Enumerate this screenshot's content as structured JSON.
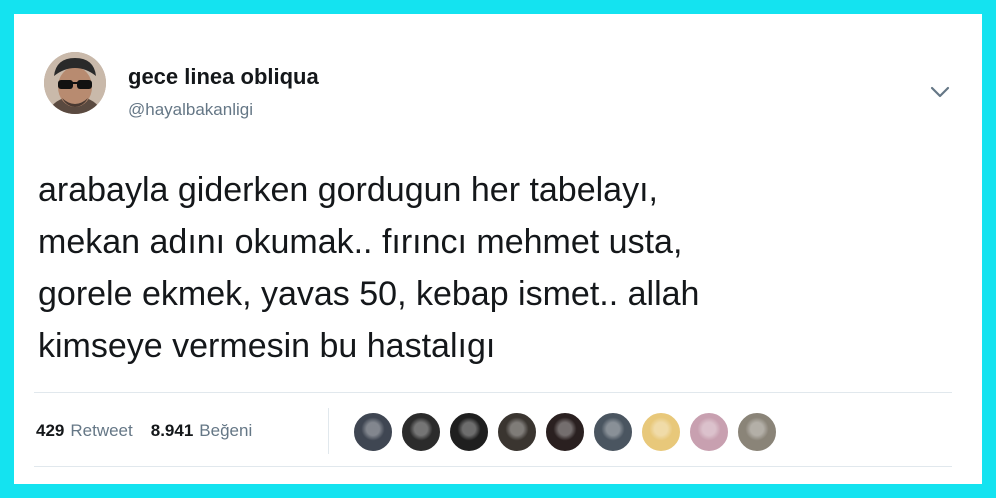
{
  "tweet": {
    "author": {
      "name": "gece linea obliqua",
      "handle": "@hayalbakanligi"
    },
    "text_lines": [
      "arabayla giderken gordugun her tabelayı,",
      "mekan adını okumak.. fırıncı mehmet usta,",
      "gorele ekmek, yavas 50, kebap ismet.. allah",
      "kimseye vermesin bu hastalıgı"
    ],
    "stats": {
      "retweet_count": "429",
      "retweet_label": "Retweet",
      "like_count": "8.941",
      "like_label": "Beğeni"
    },
    "likers": [
      {
        "name": "liker-avatar-1",
        "color": "#3f4652"
      },
      {
        "name": "liker-avatar-2",
        "color": "#2b2b2b"
      },
      {
        "name": "liker-avatar-3",
        "color": "#1f1f1f"
      },
      {
        "name": "liker-avatar-4",
        "color": "#3a3530"
      },
      {
        "name": "liker-avatar-5",
        "color": "#2a2020"
      },
      {
        "name": "liker-avatar-6",
        "color": "#4a5560"
      },
      {
        "name": "liker-avatar-7",
        "color": "#e8c87a"
      },
      {
        "name": "liker-avatar-8",
        "color": "#c8a0b0"
      },
      {
        "name": "liker-avatar-9",
        "color": "#8a8478"
      }
    ]
  },
  "icons": {
    "menu": "chevron-down-icon"
  },
  "colors": {
    "frame": "#14e3f0",
    "text": "#14171a",
    "secondary_text": "#657786",
    "divider": "#e1e8ed"
  }
}
